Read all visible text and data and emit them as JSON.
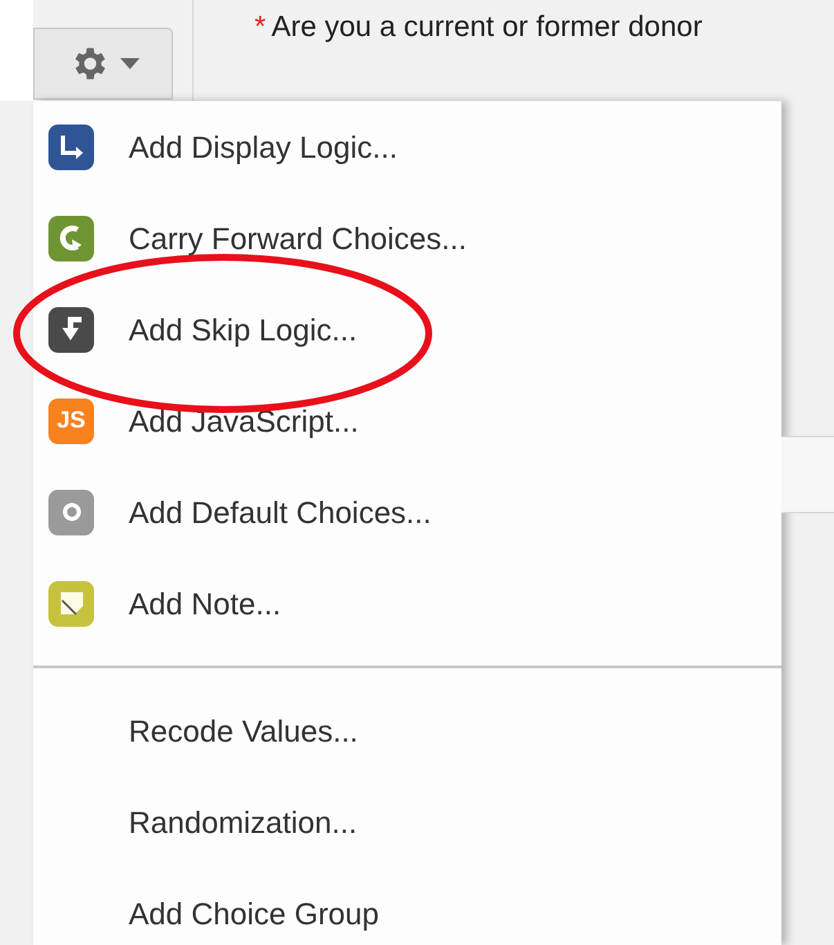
{
  "question": {
    "required_mark": "*",
    "text": "Are you a current or former donor"
  },
  "menu": {
    "items": [
      {
        "kind": "icon",
        "label": "Add Display Logic..."
      },
      {
        "kind": "icon",
        "label": "Carry Forward Choices..."
      },
      {
        "kind": "icon",
        "label": "Add Skip Logic...",
        "highlighted": true
      },
      {
        "kind": "icon",
        "label": "Add JavaScript...",
        "badge": "JS"
      },
      {
        "kind": "icon",
        "label": "Add Default Choices..."
      },
      {
        "kind": "icon",
        "label": "Add Note..."
      },
      {
        "kind": "divider"
      },
      {
        "kind": "plain",
        "label": "Recode Values..."
      },
      {
        "kind": "plain",
        "label": "Randomization..."
      },
      {
        "kind": "plain",
        "label": "Add Choice Group"
      }
    ]
  }
}
